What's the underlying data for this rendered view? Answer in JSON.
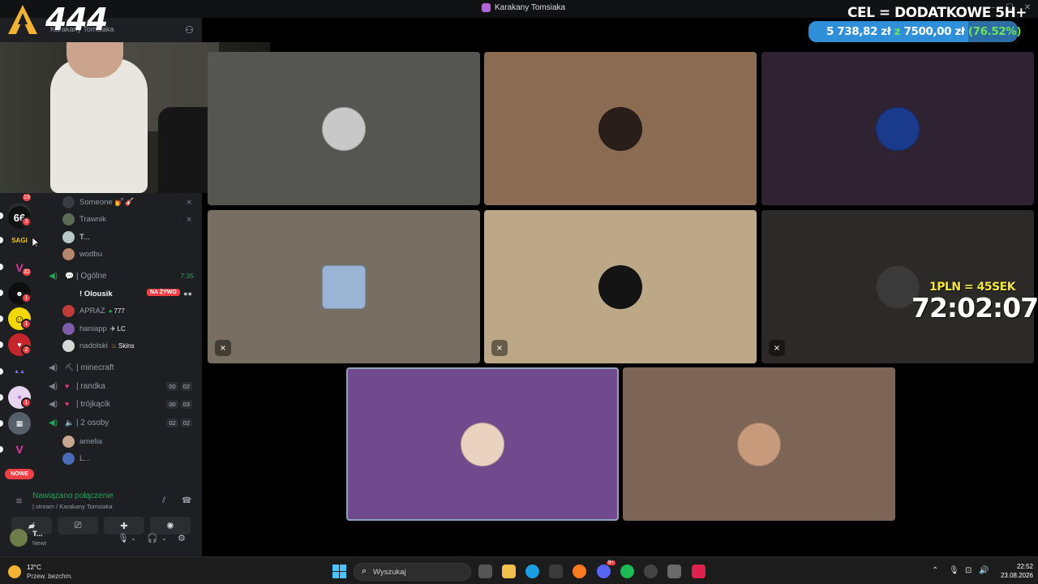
{
  "window": {
    "title": "Karakany Tomsiaka"
  },
  "overlay": {
    "logo_number": "444",
    "goal_title": "CEL = DODATKOWE 5H+",
    "goal_amount": "5 738,82 zł",
    "goal_sep": "z",
    "goal_target": "7500,00 zł",
    "goal_percent": "(76.52%)",
    "goal_progress": 0.7652,
    "rate": "1PLN = 45SEK",
    "timer": "72:02:07"
  },
  "header": {
    "server_title": "Karakany Tomsiaka"
  },
  "rail": {
    "badges": [
      "19",
      "3",
      "32",
      "1",
      "1",
      "2",
      "1",
      "1"
    ],
    "nowe_label": "NOWE"
  },
  "sidebar": {
    "users_top": [
      {
        "name": "Someone",
        "extra": "💅🎸"
      },
      {
        "name": "Trawnik"
      },
      {
        "name": "T..."
      },
      {
        "name": "wodbu"
      }
    ],
    "channel_ogolne": {
      "name": "| Ogólne",
      "time": "7:35"
    },
    "ogolne_users": [
      {
        "name": "! Olousik",
        "live": "NA ŻYWO"
      },
      {
        "name": "APRAZ",
        "tag": "777"
      },
      {
        "name": "haniapp",
        "tag": "LC"
      },
      {
        "name": "nadolski",
        "tag": "Skins"
      }
    ],
    "channels": [
      {
        "name": "| minecraft"
      },
      {
        "name": "| randka",
        "c1": "00",
        "c2": "02"
      },
      {
        "name": "| trójkącik",
        "c1": "00",
        "c2": "03"
      },
      {
        "name": "| 2 osoby",
        "c1": "02",
        "c2": "02"
      }
    ],
    "osoby_users": [
      {
        "name": "amelia"
      },
      {
        "name": "L..."
      }
    ]
  },
  "voice": {
    "status": "Nawiązano połączenie",
    "channel_path": "| stream / Karakany Tomsiaka"
  },
  "user": {
    "name": "T...",
    "status": "Newt"
  },
  "taskbar": {
    "temperature": "12°C",
    "weather": "Przew. bezchm.",
    "search_placeholder": "Wyszukaj",
    "time": "22:52",
    "date": "23.08.2026",
    "discord_badge": "9+"
  }
}
